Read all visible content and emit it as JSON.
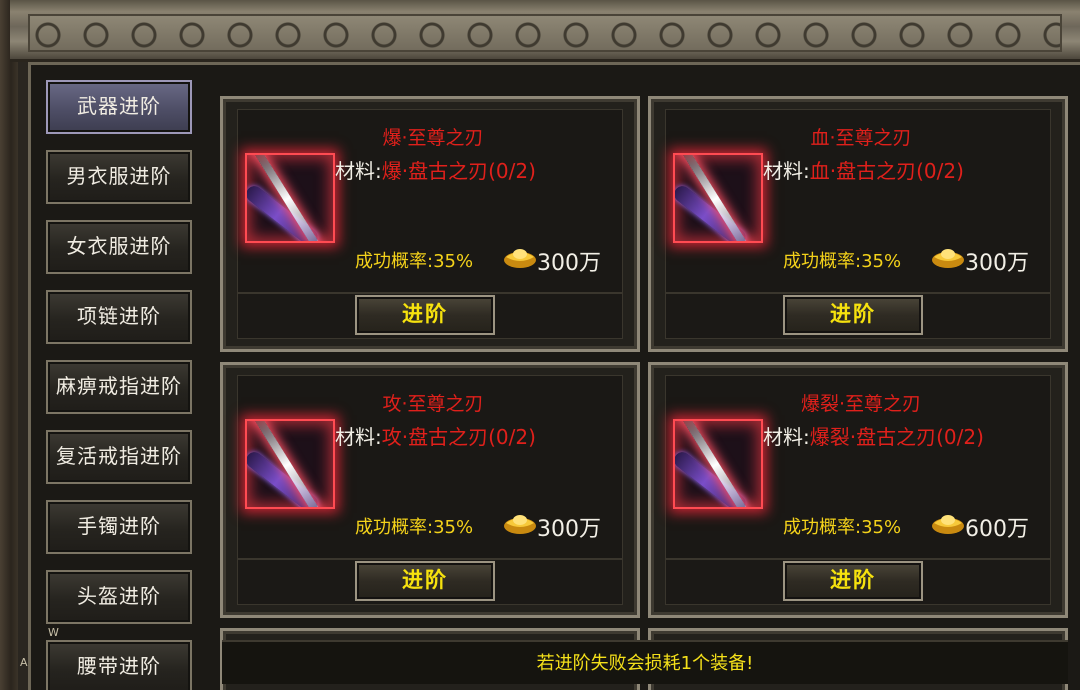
{
  "sidebar": {
    "items": [
      {
        "label": "武器进阶",
        "active": true
      },
      {
        "label": "男衣服进阶",
        "active": false
      },
      {
        "label": "女衣服进阶",
        "active": false
      },
      {
        "label": "项链进阶",
        "active": false
      },
      {
        "label": "麻痹戒指进阶",
        "active": false
      },
      {
        "label": "复活戒指进阶",
        "active": false
      },
      {
        "label": "手镯进阶",
        "active": false
      },
      {
        "label": "头盔进阶",
        "active": false
      },
      {
        "label": "腰带进阶",
        "active": false
      }
    ]
  },
  "edge_marks": {
    "w": "W",
    "a": "A"
  },
  "cards": [
    {
      "title": "爆·至尊之刃",
      "material_label": "材料:",
      "material_value": "爆·盘古之刃(0/2)",
      "rate": "成功概率:35%",
      "price": "300万",
      "button": "进阶"
    },
    {
      "title": "血·至尊之刃",
      "material_label": "材料:",
      "material_value": "血·盘古之刃(0/2)",
      "rate": "成功概率:35%",
      "price": "300万",
      "button": "进阶"
    },
    {
      "title": "攻·至尊之刃",
      "material_label": "材料:",
      "material_value": "攻·盘古之刃(0/2)",
      "rate": "成功概率:35%",
      "price": "300万",
      "button": "进阶"
    },
    {
      "title": "爆裂·至尊之刃",
      "material_label": "材料:",
      "material_value": "爆裂·盘古之刃(0/2)",
      "rate": "成功概率:35%",
      "price": "600万",
      "button": "进阶"
    }
  ],
  "notice": "若进阶失败会损耗1个装备!",
  "colors": {
    "title_red": "#e0201b",
    "rate_yellow": "#f4d21a",
    "button_yellow": "#f6e20e",
    "active_tab": "#5a5a74"
  },
  "icons": {
    "currency": "gold-ingot-icon",
    "item": "blade-item-icon"
  }
}
